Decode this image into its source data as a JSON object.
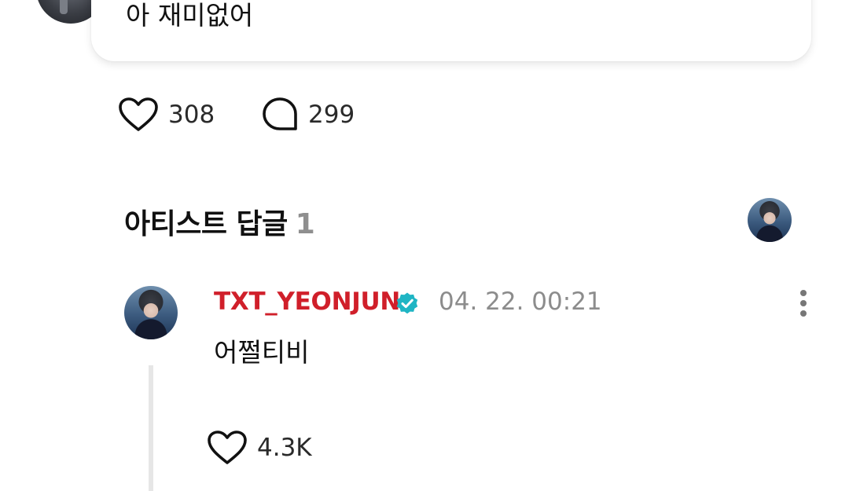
{
  "post": {
    "text": "아 재미없어",
    "like_count": "308",
    "comment_count": "299"
  },
  "artist_replies": {
    "title": "아티스트 답글",
    "count": "1"
  },
  "comment": {
    "author": "TXT_YEONJUN",
    "timestamp": "04. 22. 00:21",
    "text": "어쩔티비",
    "like_count": "4.3K"
  },
  "icons": {
    "like": "heart-icon",
    "comment": "speech-bubble-icon",
    "verified": "verified-badge-icon",
    "more": "more-vertical-icon"
  },
  "colors": {
    "author_name": "#d01f2a",
    "verified_badge": "#1fb5c4",
    "secondary_text": "#8c8c8c"
  }
}
